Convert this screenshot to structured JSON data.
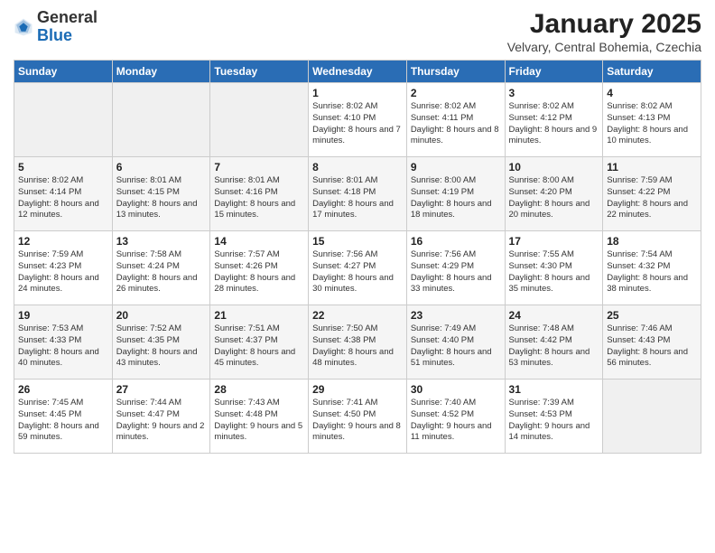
{
  "header": {
    "logo_general": "General",
    "logo_blue": "Blue",
    "month_title": "January 2025",
    "location": "Velvary, Central Bohemia, Czechia"
  },
  "days_of_week": [
    "Sunday",
    "Monday",
    "Tuesday",
    "Wednesday",
    "Thursday",
    "Friday",
    "Saturday"
  ],
  "weeks": [
    [
      {
        "day": "",
        "text": ""
      },
      {
        "day": "",
        "text": ""
      },
      {
        "day": "",
        "text": ""
      },
      {
        "day": "1",
        "text": "Sunrise: 8:02 AM\nSunset: 4:10 PM\nDaylight: 8 hours and 7 minutes."
      },
      {
        "day": "2",
        "text": "Sunrise: 8:02 AM\nSunset: 4:11 PM\nDaylight: 8 hours and 8 minutes."
      },
      {
        "day": "3",
        "text": "Sunrise: 8:02 AM\nSunset: 4:12 PM\nDaylight: 8 hours and 9 minutes."
      },
      {
        "day": "4",
        "text": "Sunrise: 8:02 AM\nSunset: 4:13 PM\nDaylight: 8 hours and 10 minutes."
      }
    ],
    [
      {
        "day": "5",
        "text": "Sunrise: 8:02 AM\nSunset: 4:14 PM\nDaylight: 8 hours and 12 minutes."
      },
      {
        "day": "6",
        "text": "Sunrise: 8:01 AM\nSunset: 4:15 PM\nDaylight: 8 hours and 13 minutes."
      },
      {
        "day": "7",
        "text": "Sunrise: 8:01 AM\nSunset: 4:16 PM\nDaylight: 8 hours and 15 minutes."
      },
      {
        "day": "8",
        "text": "Sunrise: 8:01 AM\nSunset: 4:18 PM\nDaylight: 8 hours and 17 minutes."
      },
      {
        "day": "9",
        "text": "Sunrise: 8:00 AM\nSunset: 4:19 PM\nDaylight: 8 hours and 18 minutes."
      },
      {
        "day": "10",
        "text": "Sunrise: 8:00 AM\nSunset: 4:20 PM\nDaylight: 8 hours and 20 minutes."
      },
      {
        "day": "11",
        "text": "Sunrise: 7:59 AM\nSunset: 4:22 PM\nDaylight: 8 hours and 22 minutes."
      }
    ],
    [
      {
        "day": "12",
        "text": "Sunrise: 7:59 AM\nSunset: 4:23 PM\nDaylight: 8 hours and 24 minutes."
      },
      {
        "day": "13",
        "text": "Sunrise: 7:58 AM\nSunset: 4:24 PM\nDaylight: 8 hours and 26 minutes."
      },
      {
        "day": "14",
        "text": "Sunrise: 7:57 AM\nSunset: 4:26 PM\nDaylight: 8 hours and 28 minutes."
      },
      {
        "day": "15",
        "text": "Sunrise: 7:56 AM\nSunset: 4:27 PM\nDaylight: 8 hours and 30 minutes."
      },
      {
        "day": "16",
        "text": "Sunrise: 7:56 AM\nSunset: 4:29 PM\nDaylight: 8 hours and 33 minutes."
      },
      {
        "day": "17",
        "text": "Sunrise: 7:55 AM\nSunset: 4:30 PM\nDaylight: 8 hours and 35 minutes."
      },
      {
        "day": "18",
        "text": "Sunrise: 7:54 AM\nSunset: 4:32 PM\nDaylight: 8 hours and 38 minutes."
      }
    ],
    [
      {
        "day": "19",
        "text": "Sunrise: 7:53 AM\nSunset: 4:33 PM\nDaylight: 8 hours and 40 minutes."
      },
      {
        "day": "20",
        "text": "Sunrise: 7:52 AM\nSunset: 4:35 PM\nDaylight: 8 hours and 43 minutes."
      },
      {
        "day": "21",
        "text": "Sunrise: 7:51 AM\nSunset: 4:37 PM\nDaylight: 8 hours and 45 minutes."
      },
      {
        "day": "22",
        "text": "Sunrise: 7:50 AM\nSunset: 4:38 PM\nDaylight: 8 hours and 48 minutes."
      },
      {
        "day": "23",
        "text": "Sunrise: 7:49 AM\nSunset: 4:40 PM\nDaylight: 8 hours and 51 minutes."
      },
      {
        "day": "24",
        "text": "Sunrise: 7:48 AM\nSunset: 4:42 PM\nDaylight: 8 hours and 53 minutes."
      },
      {
        "day": "25",
        "text": "Sunrise: 7:46 AM\nSunset: 4:43 PM\nDaylight: 8 hours and 56 minutes."
      }
    ],
    [
      {
        "day": "26",
        "text": "Sunrise: 7:45 AM\nSunset: 4:45 PM\nDaylight: 8 hours and 59 minutes."
      },
      {
        "day": "27",
        "text": "Sunrise: 7:44 AM\nSunset: 4:47 PM\nDaylight: 9 hours and 2 minutes."
      },
      {
        "day": "28",
        "text": "Sunrise: 7:43 AM\nSunset: 4:48 PM\nDaylight: 9 hours and 5 minutes."
      },
      {
        "day": "29",
        "text": "Sunrise: 7:41 AM\nSunset: 4:50 PM\nDaylight: 9 hours and 8 minutes."
      },
      {
        "day": "30",
        "text": "Sunrise: 7:40 AM\nSunset: 4:52 PM\nDaylight: 9 hours and 11 minutes."
      },
      {
        "day": "31",
        "text": "Sunrise: 7:39 AM\nSunset: 4:53 PM\nDaylight: 9 hours and 14 minutes."
      },
      {
        "day": "",
        "text": ""
      }
    ]
  ]
}
